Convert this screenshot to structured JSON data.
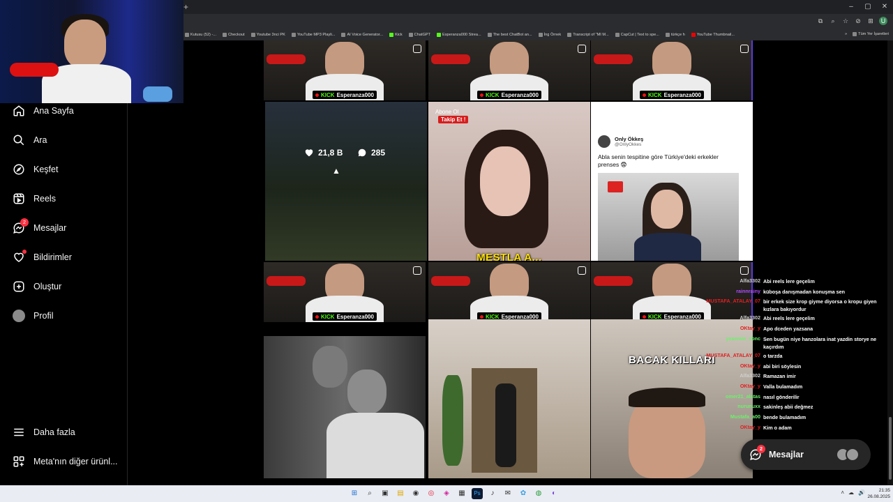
{
  "browser": {
    "new_tab": "+",
    "window_controls": [
      "–",
      "▢",
      "✕"
    ],
    "toolbar_icons": [
      "⧉",
      "⌕",
      "☆",
      "⊘",
      "⊞"
    ],
    "account_initial": "U",
    "bookmarks": [
      "Kutusu (52) -...",
      "Checkout",
      "Youtube 3nci PK",
      "YouTube MP3 Playli...",
      "AI Voice Generator...",
      "Kick",
      "ChatGPT",
      "Esperanza000 Strea...",
      "The best ChatBot an...",
      "İng Örnek",
      "Transcript of \"MI M...",
      "CapCut | Text to spe...",
      "türkçe h",
      "YouTube Thumbnail..."
    ],
    "bookmarks_overflow": "»",
    "all_bookmarks": "Tüm Yer İşaretleri"
  },
  "sidebar": {
    "items": [
      {
        "label": "Ana Sayfa",
        "icon": "home-icon"
      },
      {
        "label": "Ara",
        "icon": "search-icon"
      },
      {
        "label": "Keşfet",
        "icon": "compass-icon"
      },
      {
        "label": "Reels",
        "icon": "reels-icon"
      },
      {
        "label": "Mesajlar",
        "icon": "messenger-icon",
        "badge": "2"
      },
      {
        "label": "Bildirimler",
        "icon": "heart-icon"
      },
      {
        "label": "Oluştur",
        "icon": "plus-square-icon"
      },
      {
        "label": "Profil",
        "icon": "avatar"
      }
    ],
    "bottom": [
      {
        "label": "Daha fazla",
        "icon": "menu-icon"
      },
      {
        "label": "Meta'nın diğer ürünl...",
        "icon": "grid-icon"
      }
    ]
  },
  "grid": {
    "kick_brand": "KICK",
    "channel": "Esperanza000",
    "hover_stats": {
      "likes": "21,8 B",
      "comments": "285"
    },
    "abone_text": "Abone Ol",
    "abone_button": "Takip Et !",
    "tweet": {
      "name": "Only Ökkeş",
      "handle": "@OnlyOkkes",
      "text": "Abla senin tespitine göre Türkiye'deki erkekler prenses 😨"
    },
    "caption_mid": "MESTLA A...",
    "caption_bacak": "BACAK KILLARI"
  },
  "chat": [
    {
      "user": "Alfa3302",
      "color": "#cfcfcf",
      "msg": "Abi reels lere geçelim"
    },
    {
      "user": "rainnrainy",
      "color": "#b14bff",
      "msg": "küboşa danışmadan konuşma sen"
    },
    {
      "user": "MUSTAFA_ATALAY_07",
      "color": "#e02020",
      "msg": "bir erkek size krop giyme diyorsa o kropu giyen kızlara bakıyordur"
    },
    {
      "user": "Alfa3302",
      "color": "#cfcfcf",
      "msg": "Abi reels lere geçelim"
    },
    {
      "user": "OKtay_y",
      "color": "#e02020",
      "msg": "Apo dceden yazsana"
    },
    {
      "user": "yasemin_sbnc",
      "color": "#6cf26c",
      "msg": "Sen bugün niye hanzolara inat yazdin storye ne kaçırdım"
    },
    {
      "user": "MUSTAFA_ATALAY_07",
      "color": "#e02020",
      "msg": "o tarzda"
    },
    {
      "user": "OKtay_y",
      "color": "#e02020",
      "msg": "abi biri söylesin"
    },
    {
      "user": "Alfa3302",
      "color": "#cfcfcf",
      "msg": "Ramazan imir"
    },
    {
      "user": "OKtay_y",
      "color": "#e02020",
      "msg": "Valla bulamadım"
    },
    {
      "user": "omer21_alatas",
      "color": "#6cf26c",
      "msg": "nasıl gönderilir"
    },
    {
      "user": "nurunuxx",
      "color": "#6cf26c",
      "msg": "sakinleş abii değmez"
    },
    {
      "user": "Mustafa_a00",
      "color": "#6cf26c",
      "msg": "bende bulamadım"
    },
    {
      "user": "OKtay_y",
      "color": "#e02020",
      "msg": "Kim o adam"
    }
  ],
  "messages_pill": {
    "label": "Mesajlar",
    "badge": "2"
  },
  "taskbar": {
    "apps": [
      "⊞",
      "⌕",
      "▣",
      "▤",
      "◉",
      "◎",
      "◈",
      "▦",
      "Ps",
      "♪",
      "✉",
      "✿",
      "◍",
      "◐"
    ],
    "tray": [
      "˄",
      "☁",
      "🔊"
    ],
    "time": "21:35",
    "date": "26.08.2025"
  },
  "colors": {
    "kick_green": "#53fc18",
    "badge_red": "#ff3040",
    "accent_purple": "#5a3ad8"
  }
}
